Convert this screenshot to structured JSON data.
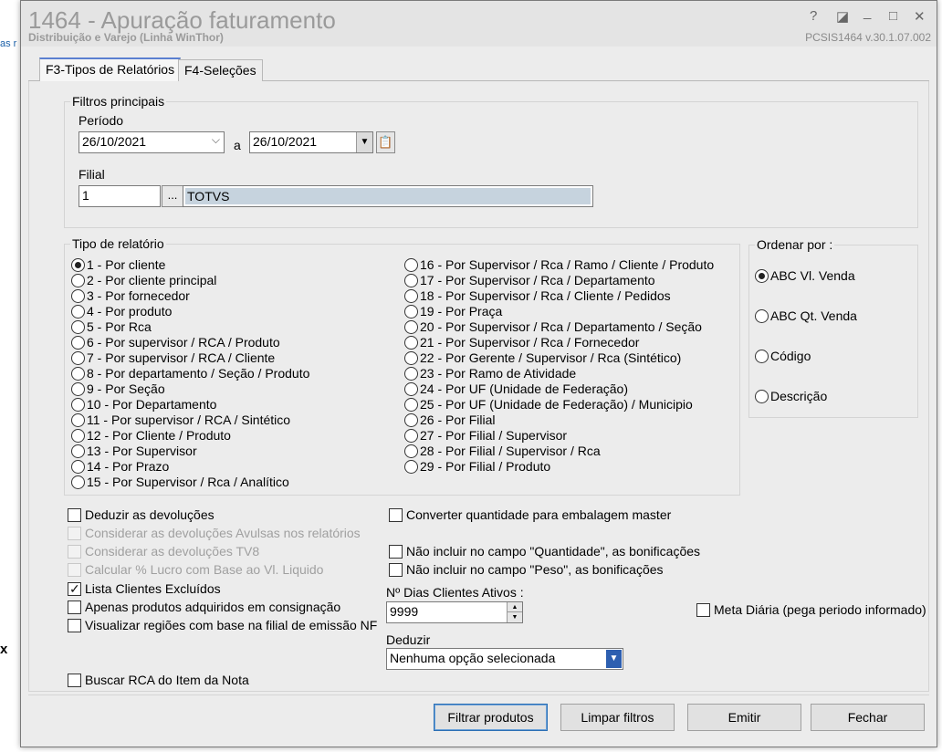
{
  "window": {
    "title": "1464 - Apuração faturamento",
    "subtitle": "Distribuição e Varejo (Linha WinThor)",
    "version": "PCSIS1464  v.30.1.07.002",
    "buttons": [
      "?",
      "◪",
      "_",
      "□",
      "✕"
    ]
  },
  "background": {
    "left_text": "as r",
    "left_x": "x"
  },
  "tabs": [
    {
      "label": "F3-Tipos de Relatórios",
      "active": true
    },
    {
      "label": "F4-Seleções",
      "active": false
    }
  ],
  "filtros": {
    "legend": "Filtros principais",
    "periodo_label": "Período",
    "date_from": "26/10/2021",
    "sep": "a",
    "date_to": "26/10/2021",
    "filial_label": "Filial",
    "filial_code": "1",
    "filial_btn": "...",
    "filial_name": "TOTVS"
  },
  "tipo_relatorio": {
    "legend": "Tipo de relatório",
    "selected": 0,
    "col1": [
      "1 - Por cliente",
      "2 - Por cliente principal",
      "3 - Por fornecedor",
      "4 - Por produto",
      "5 - Por Rca",
      "6 - Por supervisor / RCA / Produto",
      "7 - Por supervisor / RCA / Cliente",
      "8 - Por departamento / Seção / Produto",
      "9 - Por Seção",
      "10 - Por Departamento",
      "11 - Por supervisor / RCA / Sintético",
      "12 - Por Cliente / Produto",
      "13 - Por Supervisor",
      "14 - Por Prazo",
      "15 - Por Supervisor / Rca / Analítico"
    ],
    "col2": [
      "16 - Por Supervisor / Rca / Ramo /  Cliente / Produto",
      "17 - Por Supervisor / Rca / Departamento",
      "18 - Por Supervisor / Rca / Cliente / Pedidos",
      "19 - Por Praça",
      "20 - Por Supervisor / Rca / Departamento / Seção",
      "21 - Por Supervisor / Rca / Fornecedor",
      "22 - Por Gerente / Supervisor / Rca (Sintético)",
      "23 - Por Ramo de Atividade",
      "24 - Por UF (Unidade de Federação)",
      "25 - Por UF (Unidade de Federação) / Municipio",
      "26 - Por Filial",
      "27 - Por Filial / Supervisor",
      "28 - Por Filial / Supervisor / Rca",
      "29 - Por Filial / Produto"
    ]
  },
  "ordenar": {
    "legend": "Ordenar por :",
    "options": [
      "ABC Vl. Venda",
      "ABC Qt. Venda",
      "Código",
      "Descrição"
    ],
    "selected": 0
  },
  "checks_left": [
    {
      "label": "Deduzir as devoluções",
      "checked": false,
      "disabled": false
    },
    {
      "label": "Considerar as devoluções Avulsas nos relatórios",
      "checked": false,
      "disabled": true
    },
    {
      "label": "Considerar as devoluções TV8",
      "checked": false,
      "disabled": true
    },
    {
      "label": "Calcular % Lucro com Base ao Vl. Liquido",
      "checked": false,
      "disabled": true
    },
    {
      "label": "Lista Clientes Excluídos",
      "checked": true,
      "disabled": false
    },
    {
      "label": "Apenas produtos adquiridos em consignação",
      "checked": false,
      "disabled": false
    },
    {
      "label": "Visualizar regiões com base na filial de emissão NF",
      "checked": false,
      "disabled": false
    }
  ],
  "buscar_rca": {
    "label": "Buscar RCA do Item da Nota",
    "checked": false
  },
  "checks_right": [
    {
      "label": "Converter quantidade para embalagem master",
      "checked": false
    },
    {
      "label": "Não incluir no campo \"Quantidade\", as bonificações",
      "checked": false
    },
    {
      "label": "Não incluir no campo \"Peso\", as bonificações",
      "checked": false
    }
  ],
  "dias_clientes": {
    "label": "Nº Dias Clientes Ativos :",
    "value": "9999"
  },
  "meta_diaria": {
    "label": "Meta Diária (pega periodo informado)",
    "checked": false
  },
  "deduzir": {
    "label": "Deduzir",
    "value": "Nenhuma opção selecionada"
  },
  "footer_buttons": {
    "filtrar": "Filtrar produtos",
    "limpar": "Limpar filtros",
    "emitir": "Emitir",
    "fechar": "Fechar"
  },
  "colors": {
    "tab_accent": "#5a7fd0",
    "primary_border": "#2b6fb4",
    "combo_arrow": "#2d5fb0"
  }
}
